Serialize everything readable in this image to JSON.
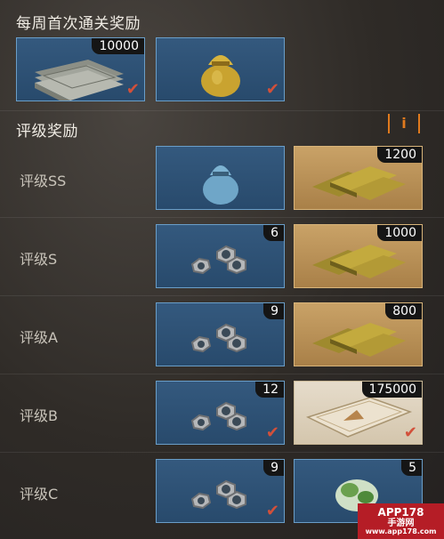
{
  "weekly": {
    "title": "每周首次通关奖励",
    "items": [
      {
        "icon": "cash-stack-icon",
        "count": "10000",
        "claimed": true
      },
      {
        "icon": "gold-sack-icon",
        "count": "",
        "claimed": true
      }
    ]
  },
  "rating": {
    "title": "评级奖励",
    "info_label": "i",
    "rows": [
      {
        "label": "评级SS",
        "left": {
          "icon": "blue-sack-icon",
          "count": "",
          "claimed": false
        },
        "right": {
          "icon": "gold-bars-icon",
          "count": "1200",
          "claimed": false
        }
      },
      {
        "label": "评级S",
        "left": {
          "icon": "hex-nuts-icon",
          "count": "6",
          "claimed": false
        },
        "right": {
          "icon": "gold-bars-icon",
          "count": "1000",
          "claimed": false
        }
      },
      {
        "label": "评级A",
        "left": {
          "icon": "hex-nuts-icon",
          "count": "9",
          "claimed": false
        },
        "right": {
          "icon": "gold-bars-icon",
          "count": "800",
          "claimed": false
        }
      },
      {
        "label": "评级B",
        "left": {
          "icon": "hex-nuts-icon",
          "count": "12",
          "claimed": true
        },
        "right": {
          "icon": "certificate-icon",
          "count": "175000",
          "claimed": true
        }
      },
      {
        "label": "评级C",
        "left": {
          "icon": "hex-nuts-icon",
          "count": "9",
          "claimed": true
        },
        "right": {
          "icon": "green-item-icon",
          "count": "5",
          "claimed": false
        }
      }
    ]
  },
  "watermark": {
    "line1": "APP178",
    "line2": "手游网",
    "line3": "www.app178.com"
  },
  "colors": {
    "accent": "#e07a1e",
    "tile_border": "#6a9ec8",
    "check": "#d2503a"
  }
}
